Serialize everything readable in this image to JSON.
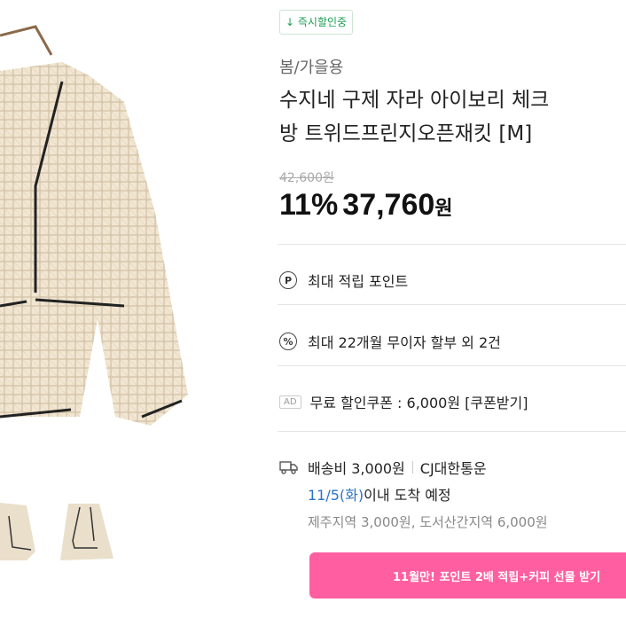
{
  "badge": {
    "arrow": "↓",
    "label": "즉시할인중"
  },
  "category": "봄/가을용",
  "title": {
    "line1": "수지네 구제 자라 아이보리 체크",
    "line2": "방 트위드프린지오픈재킷 [M]"
  },
  "price": {
    "original": "42,600원",
    "discount": "11%",
    "current": "37,760",
    "currency": "원"
  },
  "benefits": {
    "points": {
      "icon": "P",
      "label": "최대 적립 포인트"
    },
    "installment": {
      "icon": "%",
      "label": "최대 22개월 무이자 할부 외 2건"
    },
    "coupon": {
      "ad": "AD",
      "label": "무료 할인쿠폰 : 6,000원 [쿠폰받기]"
    }
  },
  "shipping": {
    "fee": "배송비 3,000원",
    "carrier": "CJ대한통운",
    "date": "11/5(화)",
    "date_suffix": " 이내 도착 예정",
    "extra": "제주지역 3,000원, 도서산간지역 6,000원"
  },
  "promo_banner": "11월만! 포인트 2배 적립+커피 선물 받기"
}
